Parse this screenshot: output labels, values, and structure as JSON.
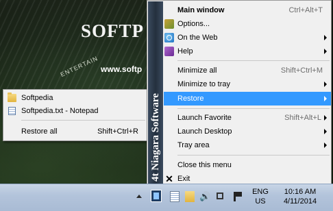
{
  "desktop": {
    "brand": "SOFTP",
    "brand_small": "ENTERTAIN",
    "brand_url": "www.softp",
    "watermark": "SOFTPEDIA"
  },
  "submenu": {
    "items": [
      {
        "label": "Softpedia",
        "icon": "folder-icon"
      },
      {
        "label": "Softpedia.txt - Notepad",
        "icon": "notepad-icon"
      }
    ],
    "restore_all": {
      "label": "Restore all",
      "shortcut": "Shift+Ctrl+R"
    }
  },
  "menu": {
    "banner": "4t Niagara Software",
    "items": [
      {
        "label": "Main window",
        "shortcut": "Ctrl+Alt+T",
        "bold": true
      },
      {
        "label": "Options...",
        "icon": "options-icon"
      },
      {
        "label": "On the Web",
        "icon": "web-icon",
        "submenu": true
      },
      {
        "label": "Help",
        "icon": "help-icon",
        "submenu": true
      },
      {
        "label": "Minimize all",
        "shortcut": "Shift+Ctrl+M"
      },
      {
        "label": "Minimize to tray",
        "submenu": true
      },
      {
        "label": "Restore",
        "submenu": true,
        "highlighted": true
      },
      {
        "label": "Launch Favorite",
        "shortcut": "Shift+Alt+L",
        "submenu": true
      },
      {
        "label": "Launch Desktop",
        "submenu": true
      },
      {
        "label": "Tray area",
        "submenu": true
      },
      {
        "label": "Close this menu"
      },
      {
        "label": "Exit",
        "icon": "close-icon"
      }
    ]
  },
  "taskbar": {
    "lang_top": "ENG",
    "lang_bottom": "US",
    "time": "10:16 AM",
    "date": "4/11/2014"
  },
  "colors": {
    "highlight": "#3399ff",
    "menu_bg": "#f0f0f0",
    "banner": "#2f3b4a"
  }
}
